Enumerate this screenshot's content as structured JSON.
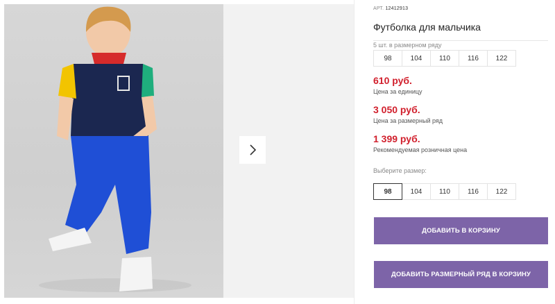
{
  "product": {
    "art_label": "АРТ.",
    "art_number": "12412913",
    "title": "Футболка для мальчика"
  },
  "size_set": {
    "label": "5 шт. в размерном ряду",
    "sizes": [
      "98",
      "104",
      "110",
      "116",
      "122"
    ]
  },
  "prices": {
    "unit_price": "610 руб.",
    "unit_note": "Цена за единицу",
    "set_price": "3 050 руб.",
    "set_note": "Цена за размерный ряд",
    "retail_price": "1 399 руб.",
    "retail_note": "Рекомендуемая розничная цена"
  },
  "size_select": {
    "label": "Выберите размер:",
    "options": [
      "98",
      "104",
      "110",
      "116",
      "122"
    ],
    "selected": "98"
  },
  "actions": {
    "add_to_cart": "ДОБАВИТЬ В КОРЗИНУ",
    "add_set_to_cart": "ДОБАВИТЬ РАЗМЕРНЫЙ РЯД В КОРЗИНУ"
  },
  "gallery": {
    "next_icon": "chevron-right-icon"
  },
  "colors": {
    "price": "#d11f2c",
    "button": "#7d64a8"
  }
}
